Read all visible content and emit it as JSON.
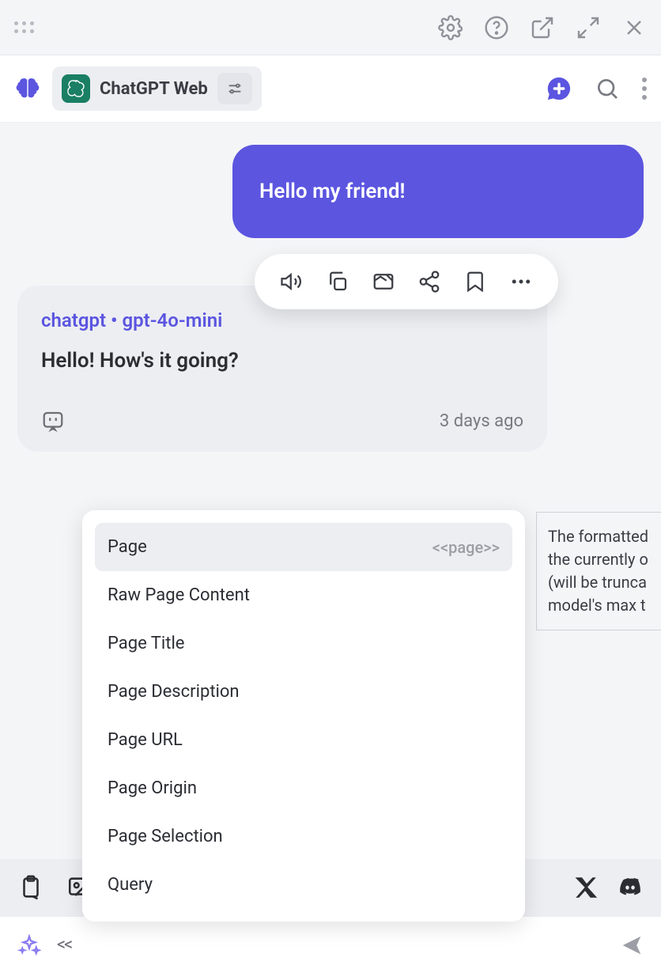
{
  "model": {
    "name": "ChatGPT Web"
  },
  "conversation": {
    "user_message": "Hello my friend!",
    "assistant_meta": "chatgpt • gpt-4o-mini",
    "assistant_text": "Hello! How's it going?",
    "timestamp": "3 days ago"
  },
  "dropdown": {
    "items": [
      {
        "label": "Page",
        "token": "<<page>>"
      },
      {
        "label": "Raw Page Content"
      },
      {
        "label": "Page Title"
      },
      {
        "label": "Page Description"
      },
      {
        "label": "Page URL"
      },
      {
        "label": "Page Origin"
      },
      {
        "label": "Page Selection"
      },
      {
        "label": "Query"
      }
    ]
  },
  "tooltip": {
    "line1": "The formatted",
    "line2": "the currently o",
    "line3": "(will be trunca",
    "line4": "model's max t"
  },
  "inputbar": {
    "chevrons": "<<"
  }
}
